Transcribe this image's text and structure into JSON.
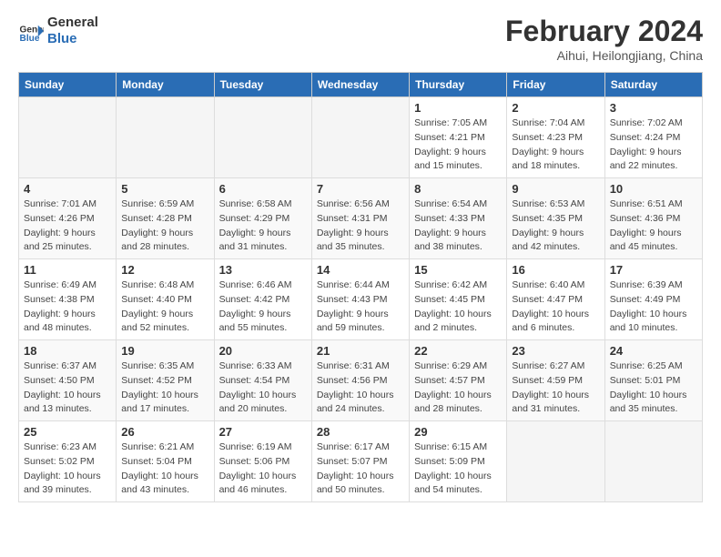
{
  "logo": {
    "text_general": "General",
    "text_blue": "Blue"
  },
  "header": {
    "title": "February 2024",
    "subtitle": "Aihui, Heilongjiang, China"
  },
  "weekdays": [
    "Sunday",
    "Monday",
    "Tuesday",
    "Wednesday",
    "Thursday",
    "Friday",
    "Saturday"
  ],
  "weeks": [
    [
      {
        "day": "",
        "detail": ""
      },
      {
        "day": "",
        "detail": ""
      },
      {
        "day": "",
        "detail": ""
      },
      {
        "day": "",
        "detail": ""
      },
      {
        "day": "1",
        "detail": "Sunrise: 7:05 AM\nSunset: 4:21 PM\nDaylight: 9 hours\nand 15 minutes."
      },
      {
        "day": "2",
        "detail": "Sunrise: 7:04 AM\nSunset: 4:23 PM\nDaylight: 9 hours\nand 18 minutes."
      },
      {
        "day": "3",
        "detail": "Sunrise: 7:02 AM\nSunset: 4:24 PM\nDaylight: 9 hours\nand 22 minutes."
      }
    ],
    [
      {
        "day": "4",
        "detail": "Sunrise: 7:01 AM\nSunset: 4:26 PM\nDaylight: 9 hours\nand 25 minutes."
      },
      {
        "day": "5",
        "detail": "Sunrise: 6:59 AM\nSunset: 4:28 PM\nDaylight: 9 hours\nand 28 minutes."
      },
      {
        "day": "6",
        "detail": "Sunrise: 6:58 AM\nSunset: 4:29 PM\nDaylight: 9 hours\nand 31 minutes."
      },
      {
        "day": "7",
        "detail": "Sunrise: 6:56 AM\nSunset: 4:31 PM\nDaylight: 9 hours\nand 35 minutes."
      },
      {
        "day": "8",
        "detail": "Sunrise: 6:54 AM\nSunset: 4:33 PM\nDaylight: 9 hours\nand 38 minutes."
      },
      {
        "day": "9",
        "detail": "Sunrise: 6:53 AM\nSunset: 4:35 PM\nDaylight: 9 hours\nand 42 minutes."
      },
      {
        "day": "10",
        "detail": "Sunrise: 6:51 AM\nSunset: 4:36 PM\nDaylight: 9 hours\nand 45 minutes."
      }
    ],
    [
      {
        "day": "11",
        "detail": "Sunrise: 6:49 AM\nSunset: 4:38 PM\nDaylight: 9 hours\nand 48 minutes."
      },
      {
        "day": "12",
        "detail": "Sunrise: 6:48 AM\nSunset: 4:40 PM\nDaylight: 9 hours\nand 52 minutes."
      },
      {
        "day": "13",
        "detail": "Sunrise: 6:46 AM\nSunset: 4:42 PM\nDaylight: 9 hours\nand 55 minutes."
      },
      {
        "day": "14",
        "detail": "Sunrise: 6:44 AM\nSunset: 4:43 PM\nDaylight: 9 hours\nand 59 minutes."
      },
      {
        "day": "15",
        "detail": "Sunrise: 6:42 AM\nSunset: 4:45 PM\nDaylight: 10 hours\nand 2 minutes."
      },
      {
        "day": "16",
        "detail": "Sunrise: 6:40 AM\nSunset: 4:47 PM\nDaylight: 10 hours\nand 6 minutes."
      },
      {
        "day": "17",
        "detail": "Sunrise: 6:39 AM\nSunset: 4:49 PM\nDaylight: 10 hours\nand 10 minutes."
      }
    ],
    [
      {
        "day": "18",
        "detail": "Sunrise: 6:37 AM\nSunset: 4:50 PM\nDaylight: 10 hours\nand 13 minutes."
      },
      {
        "day": "19",
        "detail": "Sunrise: 6:35 AM\nSunset: 4:52 PM\nDaylight: 10 hours\nand 17 minutes."
      },
      {
        "day": "20",
        "detail": "Sunrise: 6:33 AM\nSunset: 4:54 PM\nDaylight: 10 hours\nand 20 minutes."
      },
      {
        "day": "21",
        "detail": "Sunrise: 6:31 AM\nSunset: 4:56 PM\nDaylight: 10 hours\nand 24 minutes."
      },
      {
        "day": "22",
        "detail": "Sunrise: 6:29 AM\nSunset: 4:57 PM\nDaylight: 10 hours\nand 28 minutes."
      },
      {
        "day": "23",
        "detail": "Sunrise: 6:27 AM\nSunset: 4:59 PM\nDaylight: 10 hours\nand 31 minutes."
      },
      {
        "day": "24",
        "detail": "Sunrise: 6:25 AM\nSunset: 5:01 PM\nDaylight: 10 hours\nand 35 minutes."
      }
    ],
    [
      {
        "day": "25",
        "detail": "Sunrise: 6:23 AM\nSunset: 5:02 PM\nDaylight: 10 hours\nand 39 minutes."
      },
      {
        "day": "26",
        "detail": "Sunrise: 6:21 AM\nSunset: 5:04 PM\nDaylight: 10 hours\nand 43 minutes."
      },
      {
        "day": "27",
        "detail": "Sunrise: 6:19 AM\nSunset: 5:06 PM\nDaylight: 10 hours\nand 46 minutes."
      },
      {
        "day": "28",
        "detail": "Sunrise: 6:17 AM\nSunset: 5:07 PM\nDaylight: 10 hours\nand 50 minutes."
      },
      {
        "day": "29",
        "detail": "Sunrise: 6:15 AM\nSunset: 5:09 PM\nDaylight: 10 hours\nand 54 minutes."
      },
      {
        "day": "",
        "detail": ""
      },
      {
        "day": "",
        "detail": ""
      }
    ]
  ]
}
